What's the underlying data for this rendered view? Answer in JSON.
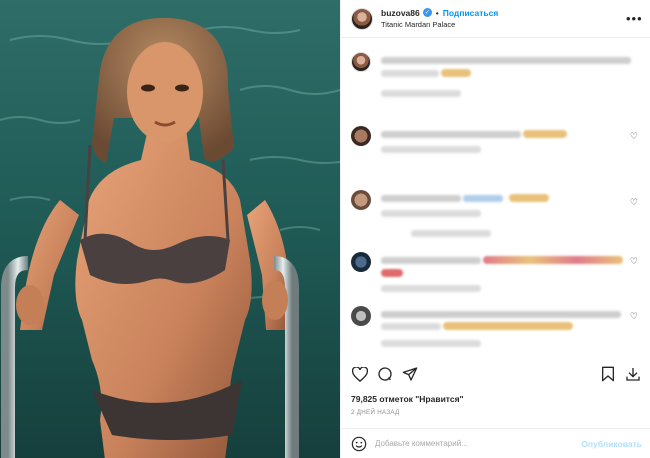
{
  "post": {
    "media": {
      "alt": "photo"
    },
    "header": {
      "username": "buzova86",
      "separator": "•",
      "follow_label": "Подписаться",
      "location": "Titanic Mardan Palace",
      "more_icon": "more-dots-icon"
    },
    "comments_blurred": true,
    "actions": {
      "icons": [
        "heart-icon",
        "comment-icon",
        "share-icon",
        "bookmark-icon",
        "download-icon"
      ]
    },
    "likes_text": "79,825 отметок \"Нравится\"",
    "time_ago": "2 ДНЕЙ НАЗАД",
    "add_comment": {
      "placeholder": "Добавьте комментарий...",
      "publish_label": "Опубликовать"
    },
    "colors": {
      "accent": "#0095f6",
      "publish_disabled": "#b2dffc",
      "text": "#262626",
      "muted": "#8e8e8e"
    }
  }
}
